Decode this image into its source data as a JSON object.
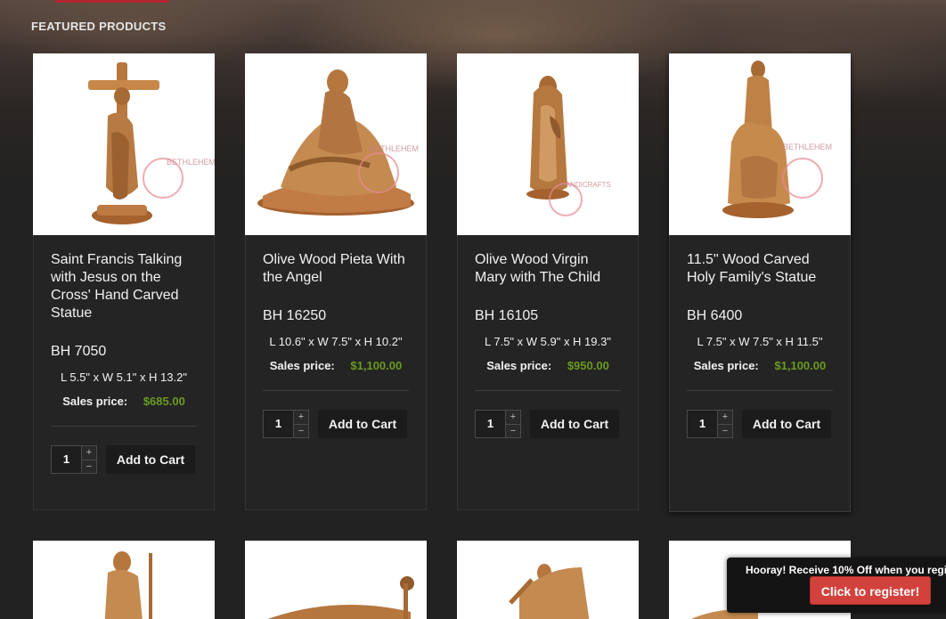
{
  "section": {
    "title": "FEATURED PRODUCTS"
  },
  "products": [
    {
      "name": "Saint Francis Talking with Jesus on the Cross' Hand Carved Statue",
      "sku": "BH 7050",
      "dimensions": "L 5.5\" x W 5.1\" x H 13.2\"",
      "price_label": "Sales price:",
      "price": "$685.00",
      "qty": "1",
      "add_label": "Add to Cart"
    },
    {
      "name": "Olive Wood Pieta With the Angel",
      "sku": "BH 16250",
      "dimensions": "L 10.6\" x W 7.5\" x H 10.2\"",
      "price_label": "Sales price:",
      "price": "$1,100.00",
      "qty": "1",
      "add_label": "Add to Cart"
    },
    {
      "name": "Olive Wood Virgin Mary with The Child",
      "sku": "BH 16105",
      "dimensions": "L 7.5\" x W 5.9\" x H 19.3\"",
      "price_label": "Sales price:",
      "price": "$950.00",
      "qty": "1",
      "add_label": "Add to Cart"
    },
    {
      "name": "11.5\" Wood Carved Holy Family's Statue",
      "sku": "BH 6400",
      "dimensions": "L 7.5\" x W 7.5\" x H 11.5\"",
      "price_label": "Sales price:",
      "price": "$1,100.00",
      "qty": "1",
      "add_label": "Add to Cart"
    }
  ],
  "watermark": {
    "line1": "BETHLEHEM",
    "line2": "HANDICRAFTS"
  },
  "qty_controls": {
    "plus": "+",
    "minus": "−"
  },
  "promo": {
    "text": "Hooray! Receive 10% Off when you regi",
    "button": "Click to register!"
  },
  "colors": {
    "accent": "#b1262f",
    "price_green": "#6a9a1f",
    "promo_button": "#d2423d",
    "wood": "#b8773e"
  }
}
